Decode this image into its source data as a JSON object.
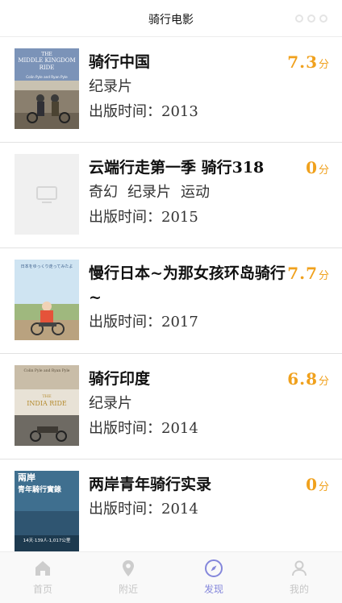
{
  "nav": {
    "title": "骑行电影"
  },
  "score_unit": "分",
  "movies": [
    {
      "title": "骑行中国",
      "genres": [
        "纪录片"
      ],
      "date_label": "出版时间：",
      "year": "2013",
      "score": "7.3"
    },
    {
      "title": "云端行走第一季 骑行318",
      "genres": [
        "奇幻",
        "纪录片",
        "运动"
      ],
      "date_label": "出版时间：",
      "year": "2015",
      "score": "0"
    },
    {
      "title": "慢行日本~为那女孩环岛骑行~",
      "genres": [],
      "date_label": "出版时间：",
      "year": "2017",
      "score": "7.7"
    },
    {
      "title": "骑行印度",
      "genres": [
        "纪录片"
      ],
      "date_label": "出版时间：",
      "year": "2014",
      "score": "6.8"
    },
    {
      "title": "两岸青年骑行实录",
      "genres": [],
      "date_label": "出版时间：",
      "year": "2014",
      "score": "0"
    }
  ],
  "posters": {
    "p1": {
      "line1": "THE",
      "line2": "MIDDLE KINGDOM",
      "line3": "RIDE",
      "credit": "Colin Pyle and Ryan Pyle"
    },
    "p2": {
      "icon": "image-placeholder-icon"
    },
    "p3": {
      "line1": "日本をゆっくり走ってみたよ"
    },
    "p4": {
      "credit": "Colin Pyle and Ryan Pyle",
      "line1": "THE",
      "line2": "INDIA RIDE"
    },
    "p5": {
      "line1": "兩岸",
      "line2": "青年騎行實錄",
      "line3": "14天·139人·1,017公里"
    }
  },
  "tabs": [
    {
      "label": "首页",
      "icon": "home-icon",
      "active": false
    },
    {
      "label": "附近",
      "icon": "location-pin-icon",
      "active": false
    },
    {
      "label": "发现",
      "icon": "compass-icon",
      "active": true
    },
    {
      "label": "我的",
      "icon": "user-icon",
      "active": false
    }
  ],
  "colors": {
    "score": "#f0a11d",
    "tab_active": "#5c5fd0",
    "tab_inactive": "#b3b3b3"
  }
}
